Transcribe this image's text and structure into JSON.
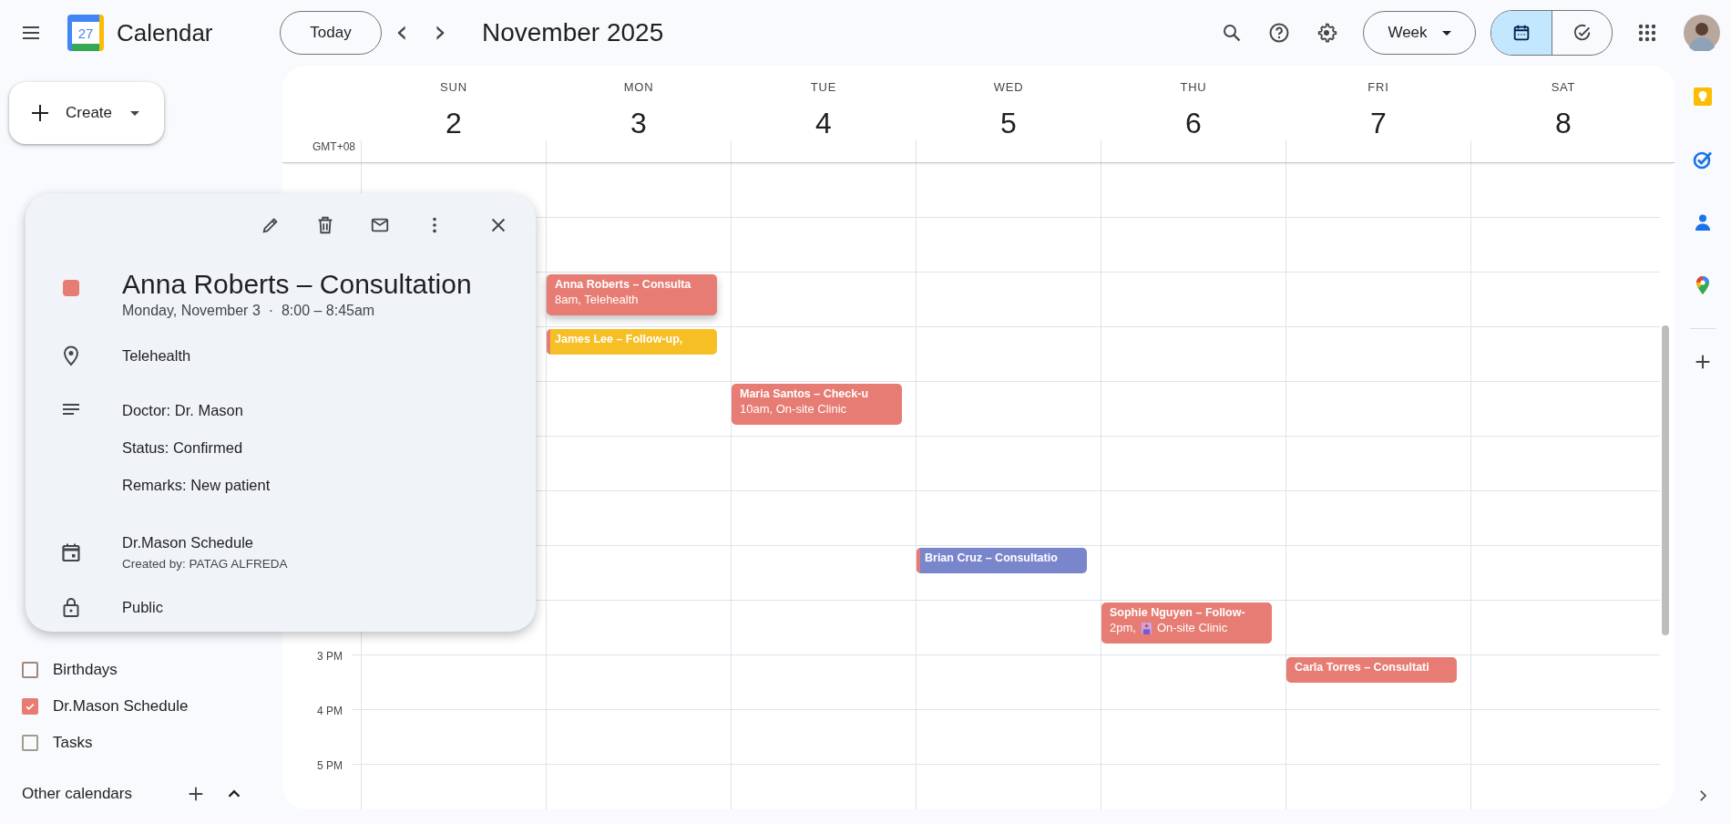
{
  "app": {
    "title": "Calendar",
    "logo_day": "27"
  },
  "toolbar": {
    "today": "Today",
    "prev": "‹",
    "next": "›",
    "period": "November 2025",
    "view": "Week"
  },
  "view_toggle": [
    {
      "kind": "calendar",
      "selected": true
    },
    {
      "kind": "tasks",
      "selected": false
    }
  ],
  "sidebar": {
    "create": "Create",
    "calendars": [
      {
        "label": "Birthdays",
        "checked": false,
        "color": "#a1887f"
      },
      {
        "label": "Dr.Mason Schedule",
        "checked": true,
        "color": "#e67c73"
      },
      {
        "label": "Tasks",
        "checked": false,
        "color": "#9e9e8e"
      }
    ],
    "other_calendars": "Other calendars"
  },
  "week": {
    "timezone": "GMT+08",
    "days": [
      {
        "name": "SUN",
        "date": "2"
      },
      {
        "name": "MON",
        "date": "3"
      },
      {
        "name": "TUE",
        "date": "4"
      },
      {
        "name": "WED",
        "date": "5"
      },
      {
        "name": "THU",
        "date": "6"
      },
      {
        "name": "FRI",
        "date": "7"
      },
      {
        "name": "SAT",
        "date": "8"
      }
    ],
    "hours": [
      {
        "label": "3 PM"
      },
      {
        "label": "4 PM"
      },
      {
        "label": "5 PM"
      }
    ],
    "events": [
      {
        "title": "Anna Roberts – Consulta",
        "time": "8am,",
        "place": "Telehealth",
        "clinic_icon": false,
        "color": "#e67c73",
        "selected": true
      },
      {
        "title": "James Lee – Follow-up,",
        "color": "#f6bf26",
        "stripe": {
          "color": "#e67c73"
        },
        "selected": false
      },
      {
        "title": "Maria Santos – Check-u",
        "time": "10am,",
        "place": "On-site Clinic",
        "clinic_icon": false,
        "color": "#e67c73",
        "selected": false
      },
      {
        "title": "Brian Cruz – Consultatio",
        "color": "#7986cb",
        "stripe": {
          "color": "#e67c73"
        },
        "selected": false
      },
      {
        "title": "Sophie Nguyen – Follow-",
        "time": "2pm,",
        "place": "On-site Clinic",
        "clinic_icon": true,
        "color": "#e67c73",
        "selected": false
      },
      {
        "title": "Carla Torres – Consultati",
        "color": "#e67c73",
        "selected": false
      }
    ]
  },
  "popup": {
    "title": "Anna Roberts – Consultation",
    "color": "#e67c73",
    "when": "Monday, November 3  ·  8:00 – 8:45am",
    "location": "Telehealth",
    "description": [
      "Doctor: Dr. Mason",
      "Status: Confirmed",
      "Remarks: New patient"
    ],
    "calendar": "Dr.Mason Schedule",
    "created_by": "Created by: PATAG ALFREDA",
    "visibility": "Public"
  }
}
